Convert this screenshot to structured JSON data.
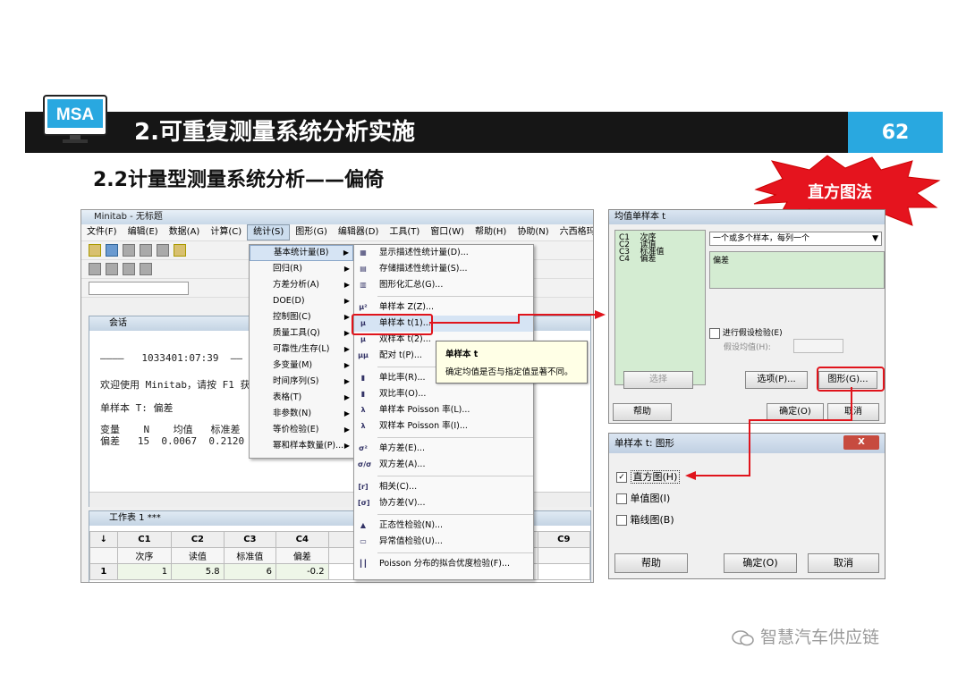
{
  "slide": {
    "logo_text": "MSA",
    "title": "2.可重复测量系统分析实施",
    "page_number": "62",
    "subtitle": "2.2计量型测量系统分析——偏倚",
    "callout": "直方图法",
    "watermark": "智慧汽车供应链"
  },
  "minitab": {
    "title": "Minitab - 无标题",
    "menu": [
      "文件(F)",
      "编辑(E)",
      "数据(A)",
      "计算(C)",
      "统计(S)",
      "图形(G)",
      "编辑器(D)",
      "工具(T)",
      "窗口(W)",
      "帮助(H)",
      "协助(N)",
      "六西格玛(X)"
    ],
    "session": {
      "title": "会话",
      "timestamp_line": "————   1033401:07:39  ——",
      "welcome": "欢迎使用 Minitab，请按 F1 获得",
      "test_title": "单样本 T: 偏差",
      "table_header": "变量    N    均值   标准差  均值",
      "table_row": "偏差   15  0.0067  0.2120"
    },
    "worksheet": {
      "title": "工作表 1 ***",
      "columns": [
        "C1",
        "C2",
        "C3",
        "C4",
        "C9"
      ],
      "names": [
        "次序",
        "读值",
        "标准值",
        "偏差"
      ],
      "row1": [
        "1",
        "1",
        "5.8",
        "6",
        "-0.2"
      ]
    }
  },
  "stat_menu": {
    "items": [
      "基本统计量(B)",
      "回归(R)",
      "方差分析(A)",
      "DOE(D)",
      "控制图(C)",
      "质量工具(Q)",
      "可靠性/生存(L)",
      "多变量(M)",
      "时间序列(S)",
      "表格(T)",
      "非参数(N)",
      "等价检验(E)",
      "幂和样本数量(P)..."
    ]
  },
  "sub_menu": {
    "items": [
      {
        "icon": "desc",
        "label": "显示描述性统计量(D)..."
      },
      {
        "icon": "store",
        "label": "存储描述性统计量(S)..."
      },
      {
        "icon": "graph",
        "label": "图形化汇总(G)..."
      },
      {
        "icon": "z",
        "label": "单样本 Z(Z)..."
      },
      {
        "icon": "t1",
        "label": "单样本 t(1)..."
      },
      {
        "icon": "t2",
        "label": "双样本 t(2)..."
      },
      {
        "icon": "pt",
        "label": "配对 t(P)..."
      },
      {
        "icon": "p1",
        "label": "单比率(R)..."
      },
      {
        "icon": "p2",
        "label": "双比率(O)..."
      },
      {
        "icon": "poi1",
        "label": "单样本 Poisson 率(L)..."
      },
      {
        "icon": "poi2",
        "label": "双样本 Poisson 率(I)..."
      },
      {
        "icon": "var1",
        "label": "单方差(E)..."
      },
      {
        "icon": "var2",
        "label": "双方差(A)..."
      },
      {
        "icon": "corr",
        "label": "相关(C)..."
      },
      {
        "icon": "cov",
        "label": "协方差(V)..."
      },
      {
        "icon": "norm",
        "label": "正态性检验(N)..."
      },
      {
        "icon": "out",
        "label": "异常值检验(U)..."
      },
      {
        "icon": "gof",
        "label": "Poisson 分布的拟合优度检验(F)..."
      }
    ]
  },
  "tooltip": {
    "title": "单样本 t",
    "text": "确定均值是否与指定值显著不同。"
  },
  "dialog1": {
    "title": "均值单样本 t",
    "columns": [
      "C1",
      "次序",
      "C2",
      "读值",
      "C3",
      "标准值",
      "C4",
      "偏差"
    ],
    "dropdown": "一个或多个样本，每列一个",
    "field_value": "偏差",
    "hypothesis_check": "进行假设检验(E)",
    "hypo_mean_label": "假设均值(H):",
    "btn_select": "选择",
    "btn_options": "选项(P)...",
    "btn_graphs": "图形(G)...",
    "btn_help": "帮助",
    "btn_ok": "确定(O)",
    "btn_cancel": "取消"
  },
  "dialog2": {
    "title": "单样本 t: 图形",
    "opt_histogram": "直方图(H)",
    "opt_individual": "单值图(I)",
    "opt_boxplot": "箱线图(B)",
    "btn_help": "帮助",
    "btn_ok": "确定(O)",
    "btn_cancel": "取消",
    "close": "X"
  },
  "colors": {
    "accent_blue": "#29a8e0",
    "highlight_red": "#e0141c",
    "header_black": "#161616"
  }
}
